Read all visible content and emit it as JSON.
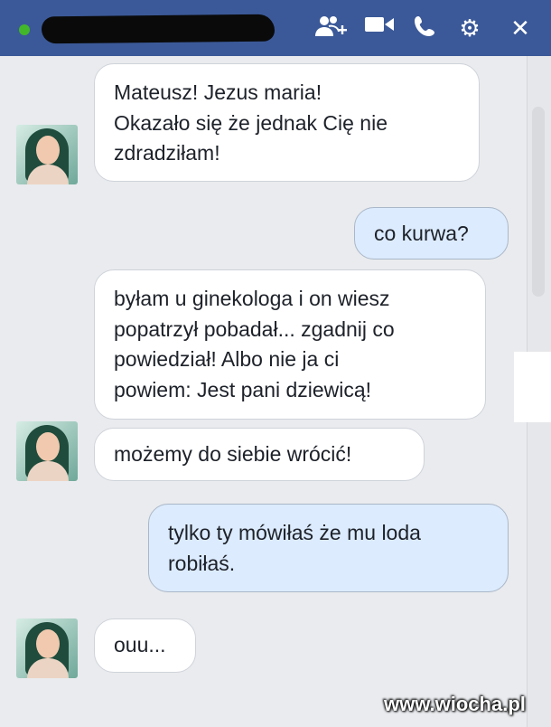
{
  "header": {
    "status": "online",
    "contact_name_redacted": true,
    "icons": [
      "add-person-icon",
      "video-camera-icon",
      "phone-icon",
      "gear-icon",
      "close-icon"
    ]
  },
  "messages": [
    {
      "from": "contact",
      "text": "Mateusz! Jezus maria!\nOkazało się że jednak Cię nie\nzdradziłam!"
    },
    {
      "from": "me",
      "text": "co kurwa?"
    },
    {
      "from": "contact",
      "text": "byłam u ginekologa i on wiesz\npopatrzył pobadał... zgadnij co\npowiedział! Albo nie ja ci\npowiem: Jest pani dziewicą!"
    },
    {
      "from": "contact",
      "text": "możemy do siebie wrócić!"
    },
    {
      "from": "me",
      "text": "tylko ty mówiłaś że mu loda\nrobiłaś."
    },
    {
      "from": "contact",
      "text": "ouu..."
    }
  ],
  "watermark": "www.wiocha.pl",
  "colors": {
    "header": "#3b5998",
    "incoming_bubble": "#ffffff",
    "outgoing_bubble": "#dcebfd",
    "status": "#42b72a"
  }
}
